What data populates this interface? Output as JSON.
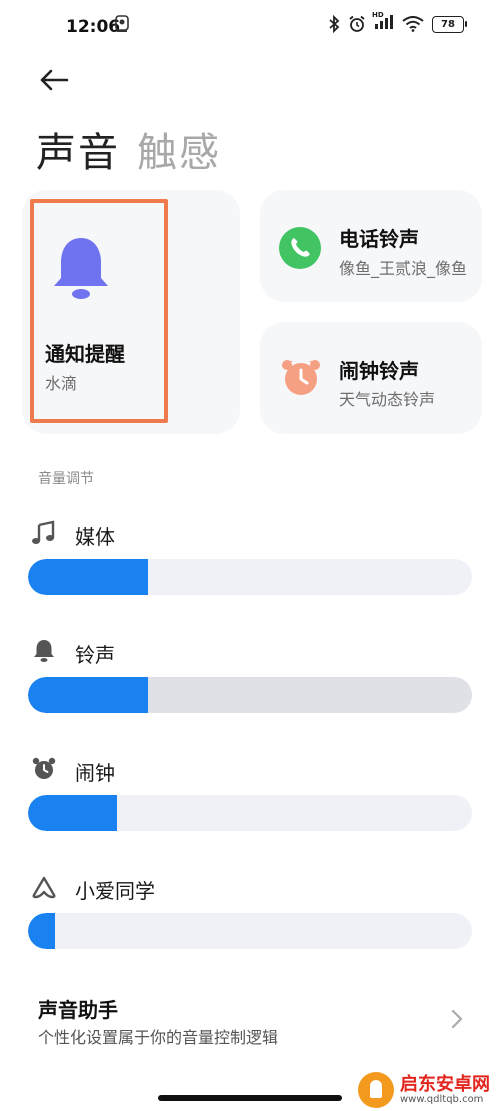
{
  "status_bar": {
    "time": "12:06",
    "battery": "78",
    "hd": "HD"
  },
  "header": {
    "title_active": "声音",
    "title_inactive": "触感"
  },
  "ringtone_cards": {
    "notification": {
      "title": "通知提醒",
      "subtitle": "水滴"
    },
    "phone": {
      "title": "电话铃声",
      "subtitle": "像鱼_王贰浪_像鱼"
    },
    "alarm": {
      "title": "闹钟铃声",
      "subtitle": "天气动态铃声"
    }
  },
  "volume": {
    "section_label": "音量调节",
    "sliders": [
      {
        "label": "媒体",
        "icon": "music-note-icon",
        "level": 0.27,
        "track_color": "#eff1f7"
      },
      {
        "label": "铃声",
        "icon": "bell-icon",
        "level": 0.27,
        "track_color": "#dfe1e6"
      },
      {
        "label": "闹钟",
        "icon": "alarm-clock-icon",
        "level": 0.2,
        "track_color": "#eff1f7"
      },
      {
        "label": "小爱同学",
        "icon": "xiaoai-icon",
        "level": 0.06,
        "track_color": "#eff1f7"
      }
    ]
  },
  "sound_assistant": {
    "title": "声音助手",
    "subtitle": "个性化设置属于你的音量控制逻辑"
  },
  "watermark": {
    "name": "启东安卓网",
    "url": "www.qdltqb.com"
  },
  "colors": {
    "accent": "#1a82f0",
    "highlight_border": "#ee7a4d",
    "notification_bell": "#6f73f0",
    "phone_green": "#43c463",
    "alarm_orange": "#f5a083"
  }
}
